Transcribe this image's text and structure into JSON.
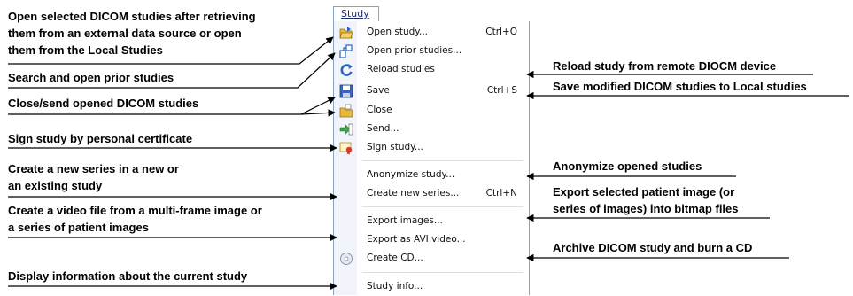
{
  "menu": {
    "title": "Study",
    "items": [
      {
        "label": "Open study...",
        "shortcut": "Ctrl+O"
      },
      {
        "label": "Open prior studies...",
        "shortcut": ""
      },
      {
        "label": "Reload studies",
        "shortcut": ""
      },
      {
        "label": "Save",
        "shortcut": "Ctrl+S"
      },
      {
        "label": "Close",
        "shortcut": ""
      },
      {
        "label": "Send...",
        "shortcut": ""
      },
      {
        "label": "Sign study...",
        "shortcut": ""
      },
      {
        "label": "Anonymize study...",
        "shortcut": ""
      },
      {
        "label": "Create new series...",
        "shortcut": "Ctrl+N"
      },
      {
        "label": "Export images...",
        "shortcut": ""
      },
      {
        "label": "Export as AVI video...",
        "shortcut": ""
      },
      {
        "label": "Create CD...",
        "shortcut": ""
      },
      {
        "label": "Study info...",
        "shortcut": ""
      }
    ]
  },
  "annotations": {
    "left": [
      "Open selected DICOM studies after retrieving",
      "them from an external data source or open",
      "them from the Local Studies",
      "Search and open prior studies",
      "Close/send opened DICOM studies",
      "Sign study by personal certificate",
      "Create a new series in a new or",
      "an existing study",
      "Create a video file from a multi-frame image or",
      "a series of patient images",
      "Display information about the current study"
    ],
    "right": [
      "Reload study from remote DIOCM device",
      "Save modified DICOM studies to Local studies",
      "Anonymize opened studies",
      "Export selected patient image (or",
      "series of images) into bitmap files",
      "Archive DICOM study and burn a CD"
    ]
  },
  "icons": [
    "open-folder-icon",
    "prior-studies-icon",
    "reload-icon",
    "save-disk-icon",
    "close-folder-icon",
    "send-icon",
    "certificate-icon",
    "cd-icon"
  ],
  "colors": {
    "menu_border": "#8aa2c4",
    "gutter": "#f1f4fa",
    "reload_blue": "#2b63c6"
  }
}
